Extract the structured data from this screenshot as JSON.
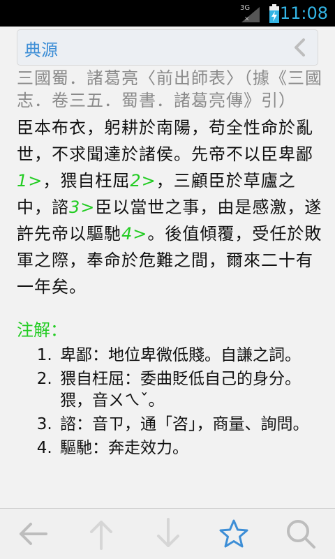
{
  "status_bar": {
    "network": "3G",
    "time": "11:08"
  },
  "header": {
    "title": "典源"
  },
  "source_text": "三國蜀．諸葛亮〈前出師表〉（據《三國志．卷三五．蜀書．諸葛亮傳》引）",
  "passage": {
    "p1": "臣本布衣，躬耕於南陽，苟全性命於亂世，不求聞達於諸侯。先帝不以臣卑鄙",
    "ref1": "1>",
    "p2": "，猥自枉屈",
    "ref2": "2>",
    "p3": "，三顧臣於草廬之中，諮",
    "ref3": "3>",
    "p4": "臣以當世之事，由是感激，遂許先帝以驅馳",
    "ref4": "4>",
    "p5": "。後值傾覆，受任於敗軍之際，奉命於危難之間，爾來二十有一年矣。"
  },
  "notes": {
    "title": "注解：",
    "items": [
      "卑鄙：地位卑微低賤。自謙之詞。",
      "猥自枉屈：委曲貶低自己的身分。猥，音ㄨㄟˇ。",
      "諮：音ㄗ，通「咨」，商量、詢問。",
      "驅馳：奔走效力。"
    ]
  },
  "bottom_bar": {
    "buttons": [
      "back-arrow-icon",
      "up-arrow-icon",
      "down-arrow-icon",
      "star-icon",
      "search-icon"
    ]
  },
  "colors": {
    "accent": "#3d8ed6",
    "note_green": "#22cc22",
    "source_gray": "#8a8a8a"
  }
}
